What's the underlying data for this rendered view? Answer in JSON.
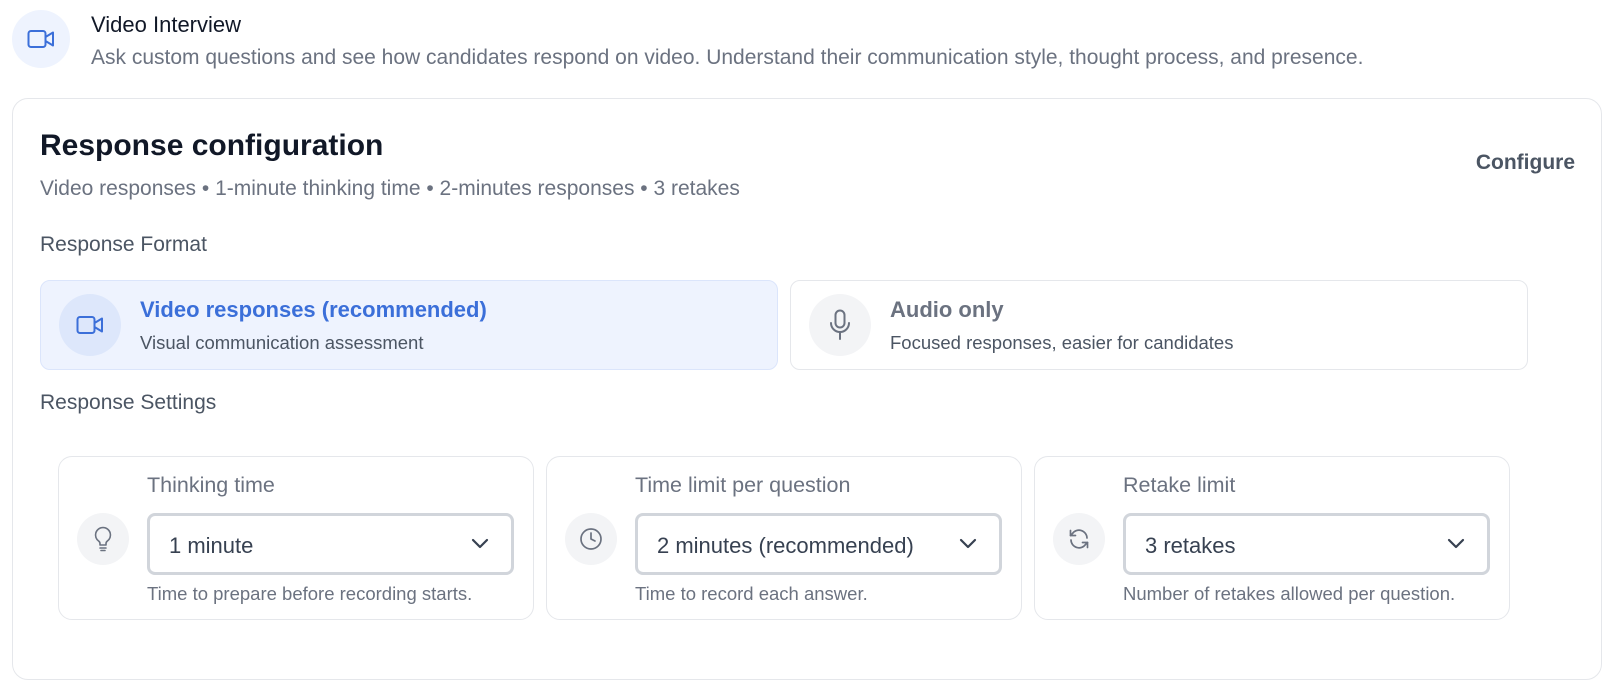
{
  "header": {
    "icon": "video-camera-icon",
    "title": "Video Interview",
    "description": "Ask custom questions and see how candidates respond on video. Understand their communication style, thought process, and presence."
  },
  "config": {
    "title": "Response configuration",
    "summary": "Video responses • 1-minute thinking time • 2-minutes responses • 3 retakes",
    "configure_label": "Configure",
    "response_format": {
      "label": "Response Format",
      "options": [
        {
          "icon": "video-camera-icon",
          "title": "Video responses (recommended)",
          "subtitle": "Visual communication assessment",
          "selected": true
        },
        {
          "icon": "microphone-icon",
          "title": "Audio only",
          "subtitle": "Focused responses, easier for candidates",
          "selected": false
        }
      ]
    },
    "response_settings": {
      "label": "Response Settings",
      "items": [
        {
          "icon": "lightbulb-icon",
          "label": "Thinking time",
          "value": "1 minute",
          "help": "Time to prepare before recording starts."
        },
        {
          "icon": "clock-icon",
          "label": "Time limit per question",
          "value": "2 minutes (recommended)",
          "help": "Time to record each answer."
        },
        {
          "icon": "refresh-icon",
          "label": "Retake limit",
          "value": "3 retakes",
          "help": "Number of retakes allowed per question."
        }
      ]
    }
  },
  "colors": {
    "accent": "#3b6fd9",
    "selected_bg": "#eef3fe",
    "border": "#e5e7eb",
    "muted_text": "#6b7280"
  }
}
